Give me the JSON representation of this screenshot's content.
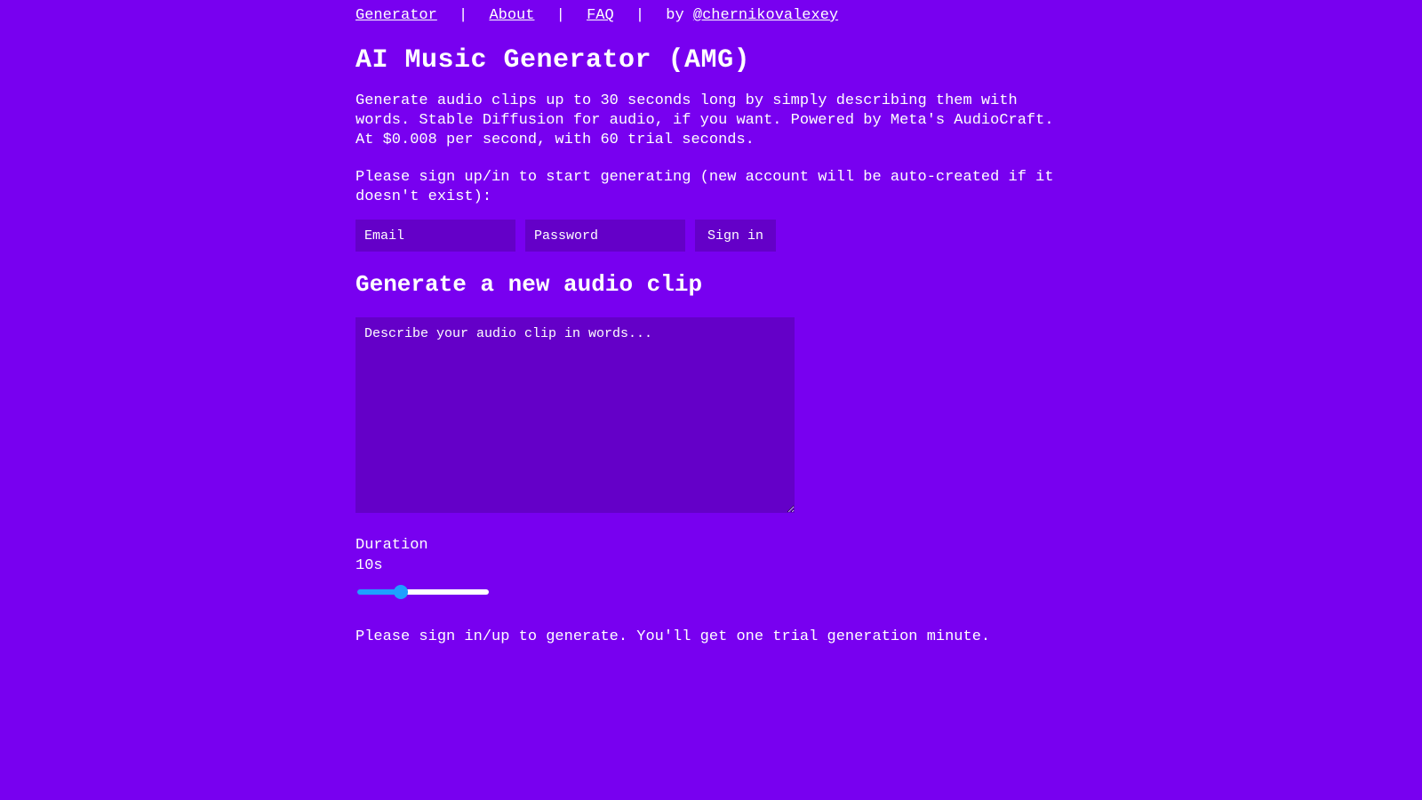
{
  "nav": {
    "generator": "Generator",
    "about": "About",
    "faq": "FAQ",
    "by_prefix": "by ",
    "author": "@chernikovalexey",
    "sep": "|"
  },
  "page_title": "AI Music Generator (AMG)",
  "description": "Generate audio clips up to 30 seconds long by simply describing them with words. Stable Diffusion for audio, if you want. Powered by Meta's AudioCraft. At $0.008 per second, with 60 trial seconds.",
  "signin_prompt": "Please sign up/in to start generating (new account will be auto-created if it doesn't exist):",
  "auth": {
    "email_placeholder": "Email",
    "password_placeholder": "Password",
    "signin_label": "Sign in"
  },
  "generate_heading": "Generate a new audio clip",
  "prompt_placeholder": "Describe your audio clip in words...",
  "duration": {
    "label": "Duration",
    "value_display": "10s",
    "value": 10,
    "min": 1,
    "max": 30
  },
  "bottom_hint": "Please sign in/up to generate. You'll get one trial generation minute."
}
